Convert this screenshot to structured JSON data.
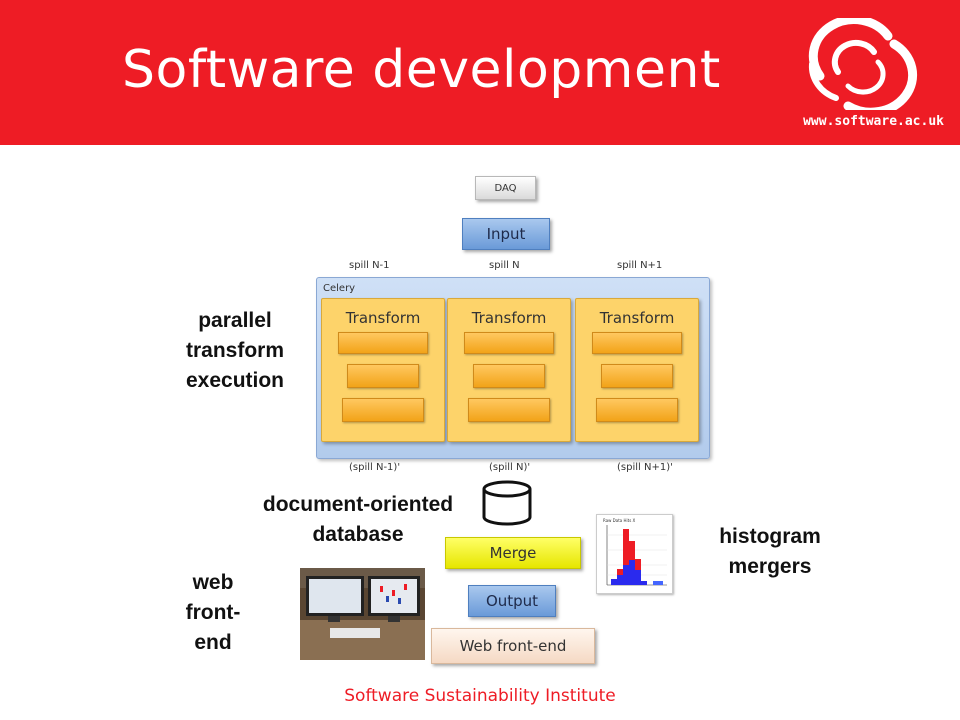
{
  "header": {
    "title": "Software development",
    "url": "www.software.ac.uk",
    "background_color": "#ee1c25",
    "logo_icon": "ssi-swirl-logo"
  },
  "diagram": {
    "daq": "DAQ",
    "input": "Input",
    "spill_top": [
      "spill N-1",
      "spill N",
      "spill N+1"
    ],
    "celery": "Celery",
    "transforms": [
      "Transform",
      "Transform",
      "Transform"
    ],
    "spill_bottom": [
      "(spill N-1)'",
      "(spill N)'",
      "(spill N+1)'"
    ],
    "merge": "Merge",
    "output": "Output",
    "web_frontend": "Web front-end",
    "database_icon": "database-cylinder-icon"
  },
  "labels": {
    "parallel": [
      "parallel",
      "transform",
      "execution"
    ],
    "database": [
      "document-oriented",
      "database"
    ],
    "histogram": [
      "histogram",
      "mergers"
    ],
    "web": [
      "web",
      "front-",
      "end"
    ]
  },
  "histogram_thumb": {
    "title": "Raw Data Hits X"
  },
  "footer": {
    "text": "Software Sustainability Institute"
  }
}
